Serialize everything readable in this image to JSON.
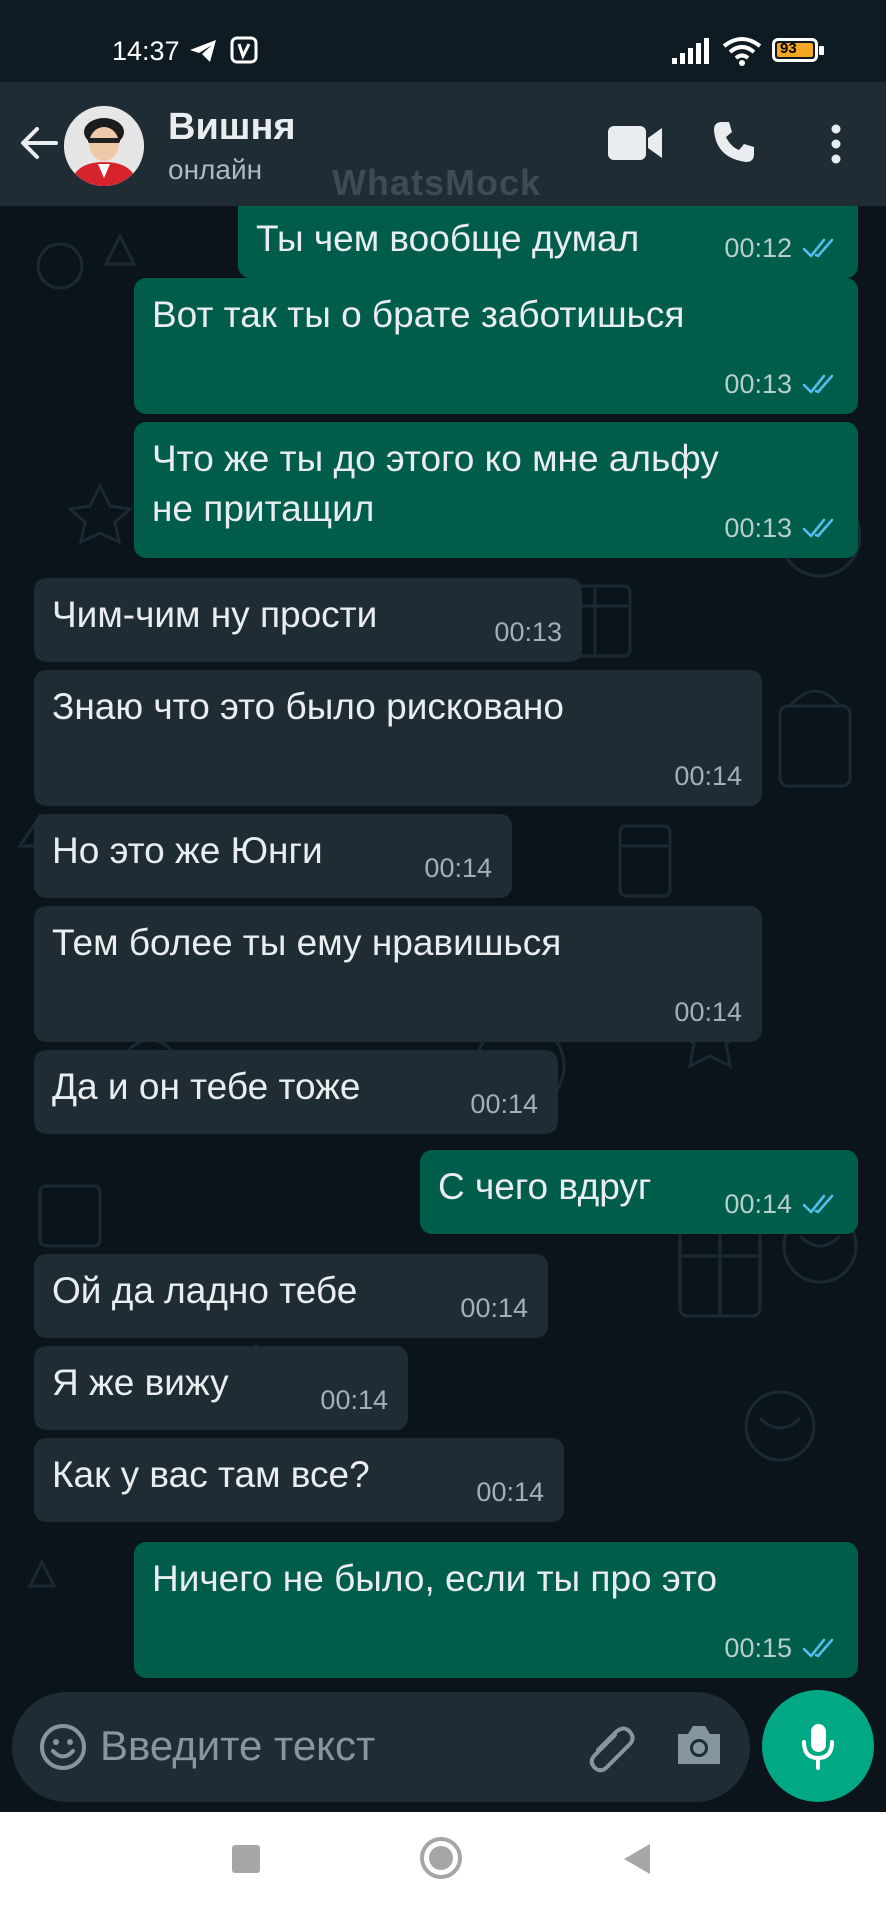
{
  "status_bar": {
    "time": "14:37",
    "battery": "93"
  },
  "header": {
    "contact_name": "Вишня",
    "contact_status": "онлайн",
    "watermark": "WhatsMock"
  },
  "messages": [
    {
      "dir": "out",
      "text": "Ты чем вообще думал",
      "time": "00:12",
      "read": true
    },
    {
      "dir": "out",
      "text": "Вот так ты о брате заботишься",
      "time": "00:13",
      "read": true
    },
    {
      "dir": "out",
      "text": "Что же ты до этого ко мне альфу\nне притащил",
      "time": "00:13",
      "read": true
    },
    {
      "dir": "in",
      "text": "Чим-чим ну прости",
      "time": "00:13"
    },
    {
      "dir": "in",
      "text": "Знаю что это было рисковано",
      "time": "00:14"
    },
    {
      "dir": "in",
      "text": "Но это же Юнги",
      "time": "00:14"
    },
    {
      "dir": "in",
      "text": "Тем более ты ему нравишься",
      "time": "00:14"
    },
    {
      "dir": "in",
      "text": "Да и он тебе тоже",
      "time": "00:14"
    },
    {
      "dir": "out",
      "text": "С чего вдруг",
      "time": "00:14",
      "read": true
    },
    {
      "dir": "in",
      "text": "Ой да ладно тебе",
      "time": "00:14"
    },
    {
      "dir": "in",
      "text": "Я же вижу",
      "time": "00:14"
    },
    {
      "dir": "in",
      "text": "Как у вас там все?",
      "time": "00:14"
    },
    {
      "dir": "out",
      "text": "Ничего не было, если ты про это",
      "time": "00:15",
      "read": true
    }
  ],
  "composer": {
    "placeholder": "Введите текст"
  },
  "colors": {
    "incoming_bubble": "#202c33",
    "outgoing_bubble": "#005c4b",
    "accent": "#00a884",
    "read_ticks": "#53bdeb"
  }
}
